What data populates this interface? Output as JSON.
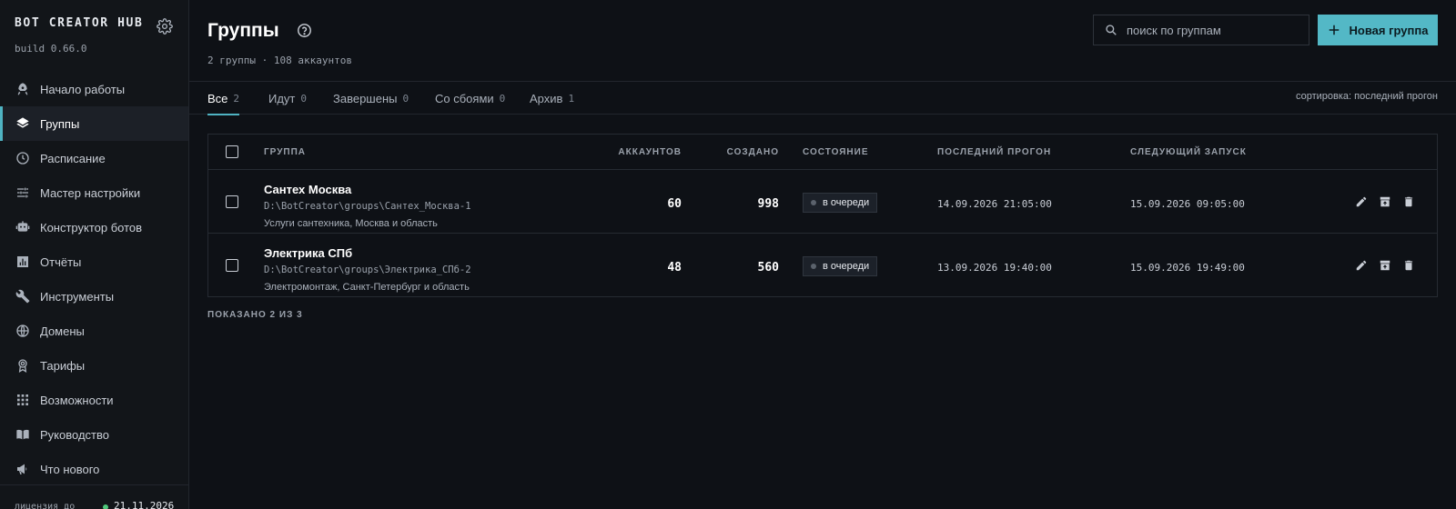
{
  "app": {
    "title": "BOT CREATOR HUB",
    "build": "build 0.66.0"
  },
  "sidebar": {
    "items": [
      {
        "label": "Начало работы",
        "icon": "rocket-icon"
      },
      {
        "label": "Группы",
        "icon": "layers-icon",
        "active": true
      },
      {
        "label": "Расписание",
        "icon": "clock-icon"
      },
      {
        "label": "Мастер настройки",
        "icon": "sliders-icon"
      },
      {
        "label": "Конструктор ботов",
        "icon": "robot-icon"
      },
      {
        "label": "Отчёты",
        "icon": "chart-icon"
      },
      {
        "label": "Инструменты",
        "icon": "wrench-icon"
      },
      {
        "label": "Домены",
        "icon": "globe-icon"
      },
      {
        "label": "Тарифы",
        "icon": "badge-icon"
      },
      {
        "label": "Возможности",
        "icon": "grid-icon"
      },
      {
        "label": "Руководство",
        "icon": "book-icon"
      },
      {
        "label": "Что нового",
        "icon": "megaphone-icon"
      }
    ],
    "license": {
      "label": "лицензия до",
      "date": "21.11.2026",
      "status_color": "#4ec77a"
    }
  },
  "header": {
    "title": "Группы",
    "subtitle": "2 группы · 108 аккаунтов",
    "search_placeholder": "поиск по группам",
    "new_button": "Новая группа"
  },
  "tabs": [
    {
      "label": "Все",
      "count": "2",
      "active": true
    },
    {
      "label": "Идут",
      "count": "0"
    },
    {
      "label": "Завершены",
      "count": "0"
    },
    {
      "label": "Со сбоями",
      "count": "0"
    },
    {
      "label": "Архив",
      "count": "1"
    }
  ],
  "sort_label": "сортировка: последний прогон",
  "table": {
    "columns": {
      "group": "ГРУППА",
      "accounts": "АККАУНТОВ",
      "created": "СОЗДАНО",
      "state": "СОСТОЯНИЕ",
      "last_run": "ПОСЛЕДНИЙ ПРОГОН",
      "next_run": "СЛЕДУЮЩИЙ ЗАПУСК"
    },
    "rows": [
      {
        "name": "Сантех Москва",
        "path": "D:\\BotCreator\\groups\\Сантех_Москва-1",
        "description": "Услуги сантехника, Москва и область",
        "accounts": "60",
        "created": "998",
        "state": "в очереди",
        "last_run": "14.09.2026 21:05:00",
        "next_run": "15.09.2026 09:05:00"
      },
      {
        "name": "Электрика СПб",
        "path": "D:\\BotCreator\\groups\\Электрика_СПб-2",
        "description": "Электромонтаж, Санкт-Петербург и область",
        "accounts": "48",
        "created": "560",
        "state": "в очереди",
        "last_run": "13.09.2026 19:40:00",
        "next_run": "15.09.2026 19:49:00"
      }
    ]
  },
  "footer": {
    "shown": "ПОКАЗАНО 2 ИЗ 3"
  },
  "colors": {
    "accent": "#53b8c6",
    "background": "#0e1116",
    "sidebar": "#121519"
  }
}
